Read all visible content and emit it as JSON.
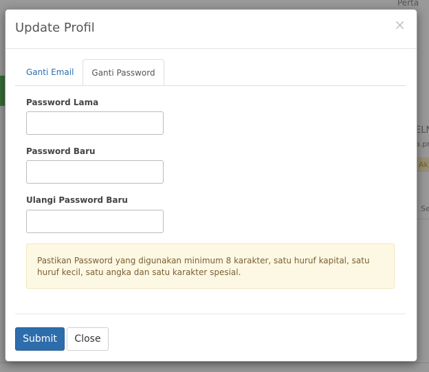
{
  "background": {
    "fragments": [
      "Perta",
      "ELN",
      "a.pr",
      "Ak",
      "Se"
    ]
  },
  "modal": {
    "title": "Update Profil",
    "close_symbol": "×",
    "tabs": [
      {
        "label": "Ganti Email",
        "active": false
      },
      {
        "label": "Ganti Password",
        "active": true
      }
    ],
    "fields": [
      {
        "label": "Password Lama",
        "value": ""
      },
      {
        "label": "Password Baru",
        "value": ""
      },
      {
        "label": "Ulangi Password Baru",
        "value": ""
      }
    ],
    "alert_text": "Pastikan Password yang digunakan minimum 8 karakter, satu huruf kapital, satu huruf kecil, satu angka dan satu karakter spesial.",
    "buttons": {
      "submit": "Submit",
      "close": "Close"
    }
  },
  "colors": {
    "primary": "#2e6dab",
    "tab_link": "#2b6fad",
    "alert_bg": "#fcf8e3"
  }
}
